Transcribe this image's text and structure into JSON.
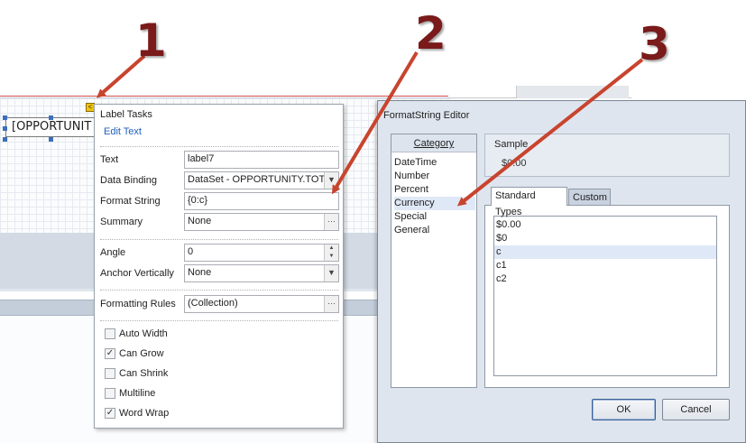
{
  "callouts": [
    "1",
    "2",
    "3"
  ],
  "designer": {
    "label_text": "[OPPORTUNIT"
  },
  "label_tasks": {
    "title": "Label Tasks",
    "edit_text_link": "Edit Text",
    "text_label": "Text",
    "text_value": "label7",
    "data_binding_label": "Data Binding",
    "data_binding_value": "DataSet - OPPORTUNITY.TOT",
    "format_string_label": "Format String",
    "format_string_value": "{0:c}",
    "summary_label": "Summary",
    "summary_value": "None",
    "angle_label": "Angle",
    "angle_value": "0",
    "anchor_label": "Anchor Vertically",
    "anchor_value": "None",
    "formatting_rules_label": "Formatting Rules",
    "formatting_rules_value": "(Collection)",
    "checks": [
      {
        "label": "Auto Width",
        "checked": false
      },
      {
        "label": "Can Grow",
        "checked": true
      },
      {
        "label": "Can Shrink",
        "checked": false
      },
      {
        "label": "Multiline",
        "checked": false
      },
      {
        "label": "Word Wrap",
        "checked": true
      }
    ]
  },
  "format_editor": {
    "title": "FormatString Editor",
    "category_header": "Category",
    "categories": [
      "DateTime",
      "Number",
      "Percent",
      "Currency",
      "Special",
      "General"
    ],
    "selected_category": "Currency",
    "sample_label": "Sample",
    "sample_value": "$0.00",
    "tab_standard": "Standard Types",
    "tab_custom": "Custom",
    "types": [
      "$0.00",
      "$0",
      "c",
      "c1",
      "c2"
    ],
    "selected_type": "c",
    "ok_label": "OK",
    "cancel_label": "Cancel"
  },
  "colors": {
    "callout": "#7a1a1a",
    "arrow": "#c8442e",
    "link": "#1f5fbf",
    "selection": "#dfe8f6"
  }
}
